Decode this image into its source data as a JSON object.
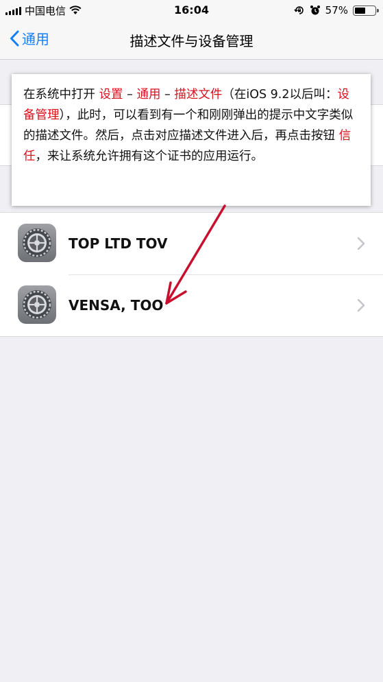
{
  "status_bar": {
    "carrier": "中国电信",
    "time": "16:04",
    "battery_percent": "57%",
    "battery_level": 0.57,
    "icons": [
      "signal-icon",
      "wifi-icon",
      "orientation-lock-icon",
      "alarm-icon",
      "battery-icon"
    ]
  },
  "nav": {
    "back_label": "通用",
    "title": "描述文件与设备管理"
  },
  "profiles": [
    {
      "name": "TOP LTD TOV",
      "icon": "settings-gear-icon"
    },
    {
      "name": "VENSA, TOO",
      "icon": "settings-gear-icon"
    }
  ],
  "annotation": {
    "parts": [
      {
        "text": "在系统中打开 ",
        "highlight": false
      },
      {
        "text": "设置",
        "highlight": true
      },
      {
        "text": " – ",
        "highlight": false
      },
      {
        "text": "通用",
        "highlight": true
      },
      {
        "text": " – ",
        "highlight": false
      },
      {
        "text": "描述文件",
        "highlight": true
      },
      {
        "text": "（在iOS 9.2以后叫：",
        "highlight": false
      },
      {
        "text": "设备管理",
        "highlight": true
      },
      {
        "text": "），此时，可以看到有一个和刚刚弹出的提示中文字类似的描述文件。然后，点击对应描述文件进入后，再点击按钮 ",
        "highlight": false
      },
      {
        "text": "信任",
        "highlight": true
      },
      {
        "text": "，来让系统允许拥有这个证书的应用运行。",
        "highlight": false
      }
    ],
    "highlight_color": "#d9121e",
    "arrow_color": "#c8102e"
  },
  "colors": {
    "ios_blue": "#157efb",
    "background": "#efeff4"
  }
}
